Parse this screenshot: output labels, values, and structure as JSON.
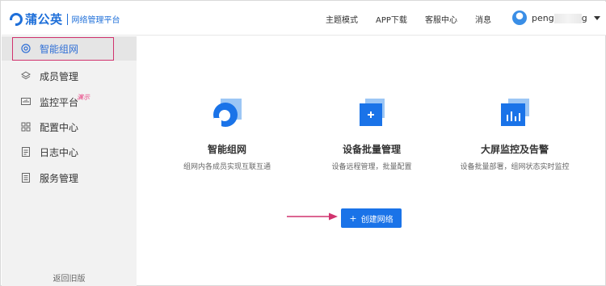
{
  "app": {
    "brand": "蒲公英",
    "subtitle": "网络管理平台"
  },
  "header": {
    "nav": [
      "主题模式",
      "APP下载",
      "客服中心",
      "消息"
    ],
    "user": {
      "name_start": "peng",
      "name_end": "g"
    }
  },
  "sidebar": {
    "items": [
      {
        "label": "智能组网",
        "icon": "network-icon",
        "active": true
      },
      {
        "label": "成员管理",
        "icon": "layers-icon"
      },
      {
        "label": "监控平台",
        "icon": "monitor-icon",
        "badge": "演示"
      },
      {
        "label": "配置中心",
        "icon": "grid-icon"
      },
      {
        "label": "日志中心",
        "icon": "log-icon"
      },
      {
        "label": "服务管理",
        "icon": "service-icon"
      }
    ],
    "footer_link": "返回旧版"
  },
  "features": [
    {
      "title": "智能组网",
      "desc": "组网内各成员实现互联互通",
      "icon": "network-icon"
    },
    {
      "title": "设备批量管理",
      "desc": "设备远程管理，批量配置",
      "icon": "add-device-icon"
    },
    {
      "title": "大屏监控及告警",
      "desc": "设备批量部署，组网状态实时监控",
      "icon": "dashboard-chart-icon"
    }
  ],
  "actions": {
    "create_network": "创建网络"
  },
  "colors": {
    "brand": "#1e6fd9",
    "button": "#1a73e8",
    "annotation": "#d1336e"
  }
}
